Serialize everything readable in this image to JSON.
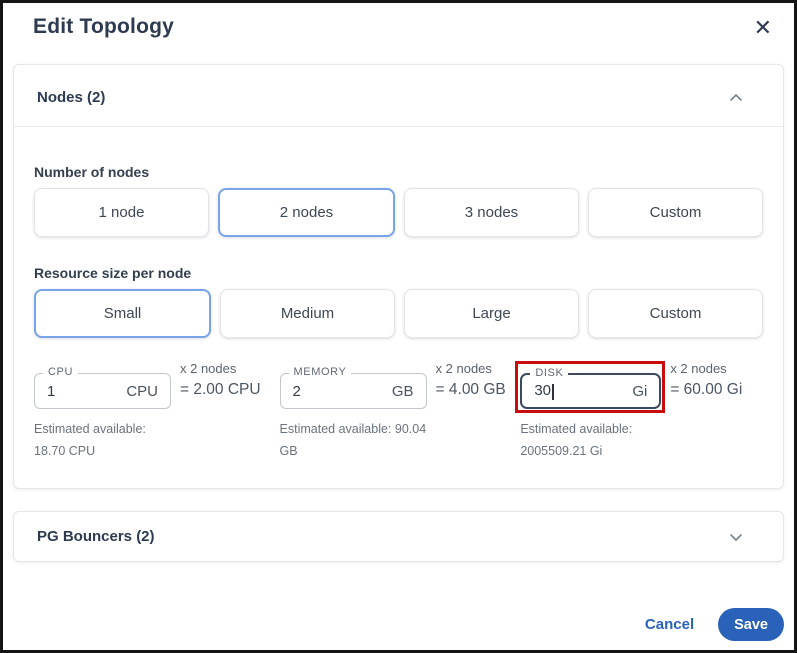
{
  "dialog": {
    "title": "Edit Topology",
    "close_icon": "✕"
  },
  "nodes_section": {
    "title": "Nodes (2)",
    "collapse_icon": "chevron-up",
    "number_of_nodes_label": "Number of nodes",
    "node_options": [
      {
        "label": "1 node",
        "selected": false
      },
      {
        "label": "2 nodes",
        "selected": true
      },
      {
        "label": "3 nodes",
        "selected": false
      },
      {
        "label": "Custom",
        "selected": false
      }
    ],
    "resource_size_label": "Resource size per node",
    "size_options": [
      {
        "label": "Small",
        "selected": true
      },
      {
        "label": "Medium",
        "selected": false
      },
      {
        "label": "Large",
        "selected": false
      },
      {
        "label": "Custom",
        "selected": false
      }
    ],
    "resources": [
      {
        "label": "CPU",
        "value": "1",
        "unit": "CPU",
        "multiplier": "x 2 nodes",
        "total": "= 2.00 CPU",
        "estimated": "Estimated available: 18.70 CPU",
        "focused": false,
        "highlighted": false
      },
      {
        "label": "MEMORY",
        "value": "2",
        "unit": "GB",
        "multiplier": "x 2 nodes",
        "total": "= 4.00 GB",
        "estimated": "Estimated available: 90.04 GB",
        "focused": false,
        "highlighted": false
      },
      {
        "label": "DISK",
        "value": "30",
        "unit": "Gi",
        "multiplier": "x 2 nodes",
        "total": "= 60.00 Gi",
        "estimated": "Estimated available: 2005509.21 Gi",
        "focused": true,
        "highlighted": true
      }
    ]
  },
  "pg_bouncers_section": {
    "title": "PG Bouncers (2)",
    "expand_icon": "chevron-down"
  },
  "footer": {
    "cancel_label": "Cancel",
    "save_label": "Save"
  },
  "colors": {
    "accent_blue": "#2a62b9",
    "selected_option_border": "#78a4e9",
    "annotation_red": "#c90c0c",
    "title_text": "#2d3a50"
  }
}
